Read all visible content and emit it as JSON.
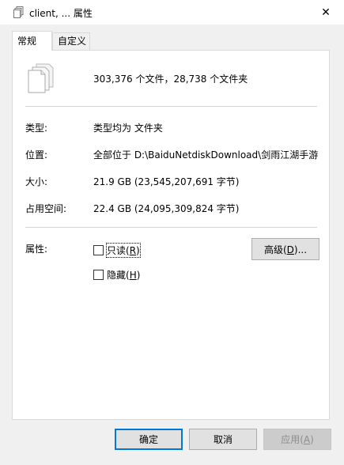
{
  "window": {
    "title": "client, ... 属性",
    "close_glyph": "✕"
  },
  "tabs": [
    {
      "label": "常规"
    },
    {
      "label": "自定义"
    }
  ],
  "general": {
    "summary": "303,376 个文件，28,738 个文件夹",
    "rows": [
      {
        "label": "类型:",
        "value": "类型均为 文件夹"
      },
      {
        "label": "位置:",
        "value": "全部位于 D:\\BaiduNetdiskDownload\\剑雨江湖手游"
      },
      {
        "label": "大小:",
        "value": "21.9 GB (23,545,207,691 字节)"
      },
      {
        "label": "占用空间:",
        "value": "22.4 GB (24,095,309,824 字节)"
      }
    ],
    "attributes_label": "属性:",
    "readonly": {
      "prefix": "只读(",
      "key": "R",
      "suffix": ")",
      "checked": false
    },
    "hidden": {
      "prefix": "隐藏(",
      "key": "H",
      "suffix": ")",
      "checked": false
    },
    "advanced": {
      "prefix": "高级(",
      "key": "D",
      "suffix": ")..."
    }
  },
  "buttons": {
    "ok": "确定",
    "cancel": "取消",
    "apply": {
      "prefix": "应用(",
      "key": "A",
      "suffix": ")"
    }
  },
  "colors": {
    "accent": "#0078d7",
    "disabled_text": "#8d8d8d"
  }
}
